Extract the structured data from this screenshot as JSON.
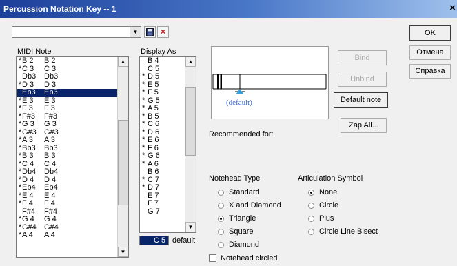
{
  "window": {
    "title": "Percussion Notation Key -- 1",
    "close_glyph": "×"
  },
  "toolbar": {
    "preset_value": "",
    "save_icon": "floppy-icon",
    "delete_glyph": "×"
  },
  "midi_note": {
    "label": "MIDI Note",
    "rows": [
      {
        "star": "*",
        "a": "B 2",
        "b": "B 2"
      },
      {
        "star": "*",
        "a": "C 3",
        "b": "C 3"
      },
      {
        "star": "",
        "a": "Db3",
        "b": "Db3"
      },
      {
        "star": "*",
        "a": "D 3",
        "b": "D 3"
      },
      {
        "star": "",
        "a": "Eb3",
        "b": "Eb3",
        "selected": true
      },
      {
        "star": "*",
        "a": "E 3",
        "b": "E 3"
      },
      {
        "star": "*",
        "a": "F 3",
        "b": "F 3"
      },
      {
        "star": "*",
        "a": "F#3",
        "b": "F#3"
      },
      {
        "star": "*",
        "a": "G 3",
        "b": "G 3"
      },
      {
        "star": "*",
        "a": "G#3",
        "b": "G#3"
      },
      {
        "star": "*",
        "a": "A 3",
        "b": "A 3"
      },
      {
        "star": "*",
        "a": "Bb3",
        "b": "Bb3"
      },
      {
        "star": "*",
        "a": "B 3",
        "b": "B 3"
      },
      {
        "star": "*",
        "a": "C 4",
        "b": "C 4"
      },
      {
        "star": "*",
        "a": "Db4",
        "b": "Db4"
      },
      {
        "star": "*",
        "a": "D 4",
        "b": "D 4"
      },
      {
        "star": "*",
        "a": "Eb4",
        "b": "Eb4"
      },
      {
        "star": "*",
        "a": "E 4",
        "b": "E 4"
      },
      {
        "star": "*",
        "a": "F 4",
        "b": "F 4"
      },
      {
        "star": "",
        "a": "F#4",
        "b": "F#4"
      },
      {
        "star": "*",
        "a": "G 4",
        "b": "G 4"
      },
      {
        "star": "*",
        "a": "G#4",
        "b": "G#4"
      },
      {
        "star": "*",
        "a": "A 4",
        "b": "A 4"
      }
    ]
  },
  "display_as": {
    "label": "Display As",
    "rows": [
      {
        "star": "",
        "a": "B 4"
      },
      {
        "star": "",
        "a": "C 5"
      },
      {
        "star": "*",
        "a": "D 5"
      },
      {
        "star": "*",
        "a": "E 5"
      },
      {
        "star": "*",
        "a": "F 5"
      },
      {
        "star": "*",
        "a": "G 5"
      },
      {
        "star": "*",
        "a": "A 5"
      },
      {
        "star": "*",
        "a": "B 5"
      },
      {
        "star": "*",
        "a": "C 6"
      },
      {
        "star": "*",
        "a": "D 6"
      },
      {
        "star": "*",
        "a": "E 6"
      },
      {
        "star": "*",
        "a": "F 6"
      },
      {
        "star": "*",
        "a": "G 6"
      },
      {
        "star": "*",
        "a": "A 6"
      },
      {
        "star": "",
        "a": "B 6"
      },
      {
        "star": "*",
        "a": "C 7"
      },
      {
        "star": "*",
        "a": "D 7"
      },
      {
        "star": "",
        "a": "E 7"
      },
      {
        "star": "",
        "a": "F 7"
      },
      {
        "star": "",
        "a": "G 7"
      }
    ],
    "current_value": "C 5",
    "default_label": "default"
  },
  "preview": {
    "default_caption": "(default)"
  },
  "buttons": {
    "bind": "Bind",
    "unbind": "Unbind",
    "default_note": "Default note",
    "zap_all": "Zap All...",
    "ok": "OK",
    "cancel": "Отмена",
    "help": "Справка"
  },
  "recommended_for": "Recommended for:",
  "notehead": {
    "label": "Notehead Type",
    "options": [
      "Standard",
      "X and Diamond",
      "Triangle",
      "Square",
      "Diamond"
    ],
    "selected": "Triangle"
  },
  "articulation": {
    "label": "Articulation Symbol",
    "options": [
      "None",
      "Circle",
      "Plus",
      "Circle Line Bisect"
    ],
    "selected": "None"
  },
  "notehead_circled": {
    "label": "Notehead circled",
    "checked": false
  }
}
